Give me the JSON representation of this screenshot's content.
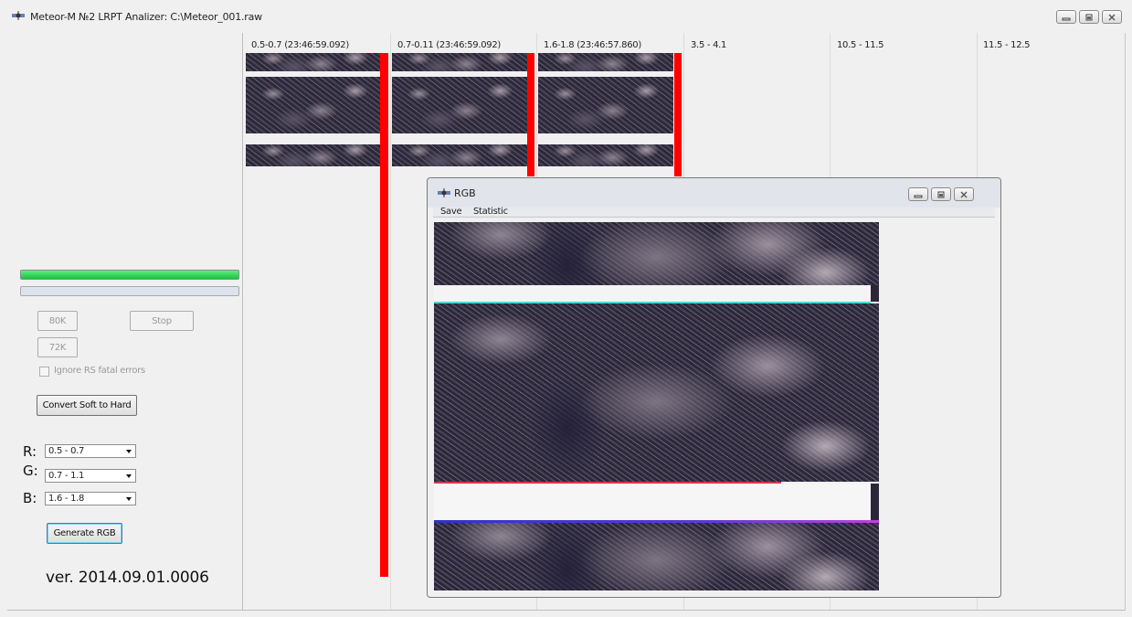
{
  "window": {
    "title": "Meteor-M №2 LRPT Analizer: C:\\Meteor_001.raw",
    "controls": [
      "minimize-icon",
      "maximize-icon",
      "close-icon"
    ]
  },
  "left_panel": {
    "progress_primary": 1.0,
    "progress_secondary": 0.0,
    "accent_color": "#18c43e",
    "buttons": {
      "k80": "80K",
      "stop": "Stop",
      "k72": "72K",
      "convert": "Convert Soft to Hard",
      "generate": "Generate RGB"
    },
    "ignore_rs_label": "Ignore RS fatal errors",
    "ignore_rs_checked": false,
    "channels": {
      "r_label": "R:",
      "r_value": "0.5 - 0.7",
      "g_label": "G:",
      "g_value": "0.7 - 1.1",
      "b_label": "B:",
      "b_value": "1.6 - 1.8"
    },
    "version": "ver. 2014.09.01.0006"
  },
  "channels": [
    {
      "label": "0.5-0.7 (23:46:59.092)"
    },
    {
      "label": "0.7-0.11 (23:46:59.092)"
    },
    {
      "label": "1.6-1.8 (23:46:57.860)"
    },
    {
      "label": "3.5 - 4.1"
    },
    {
      "label": "10.5 - 11.5"
    },
    {
      "label": "11.5 - 12.5"
    }
  ],
  "marker_color": "#ff0000",
  "rgb_window": {
    "title": "RGB",
    "menu": {
      "save": "Save",
      "statistic": "Statistic"
    }
  }
}
